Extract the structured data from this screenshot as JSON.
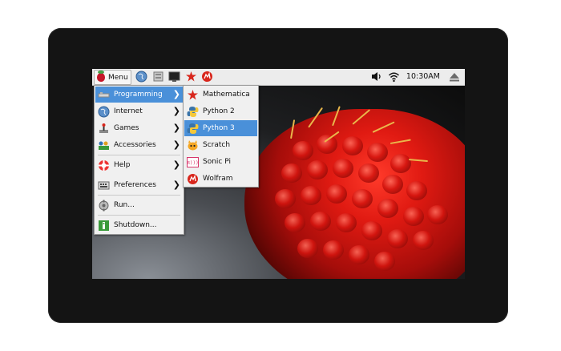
{
  "taskbar": {
    "menu_label": "Menu",
    "clock": "10:30AM",
    "icons": [
      "raspberry-icon",
      "globe-icon",
      "file-manager-icon",
      "terminal-icon",
      "mathematica-icon",
      "wolfram-icon",
      "volume-icon",
      "wifi-icon",
      "eject-icon"
    ]
  },
  "main_menu": {
    "items": [
      {
        "label": "Programming",
        "icon": "programming-icon",
        "submenu": true,
        "selected": true
      },
      {
        "label": "Internet",
        "icon": "globe-icon",
        "submenu": true
      },
      {
        "label": "Games",
        "icon": "games-icon",
        "submenu": true
      },
      {
        "label": "Accessories",
        "icon": "accessories-icon",
        "submenu": true
      },
      {
        "label": "Help",
        "icon": "help-icon",
        "submenu": true
      },
      {
        "label": "Preferences",
        "icon": "preferences-icon",
        "submenu": true
      },
      {
        "label": "Run...",
        "icon": "run-icon",
        "submenu": false
      },
      {
        "label": "Shutdown...",
        "icon": "shutdown-icon",
        "submenu": false
      }
    ]
  },
  "programming_menu": {
    "items": [
      {
        "label": "Mathematica",
        "icon": "mathematica-icon"
      },
      {
        "label": "Python 2",
        "icon": "python-icon"
      },
      {
        "label": "Python 3",
        "icon": "python-icon",
        "selected": true
      },
      {
        "label": "Scratch",
        "icon": "scratch-icon"
      },
      {
        "label": "Sonic Pi",
        "icon": "sonic-pi-icon"
      },
      {
        "label": "Wolfram",
        "icon": "wolfram-icon"
      }
    ]
  },
  "colors": {
    "selection": "#4a90d9",
    "taskbar": "#ececec",
    "bezel": "#141414",
    "menu_bg": "#f0f0f0"
  }
}
